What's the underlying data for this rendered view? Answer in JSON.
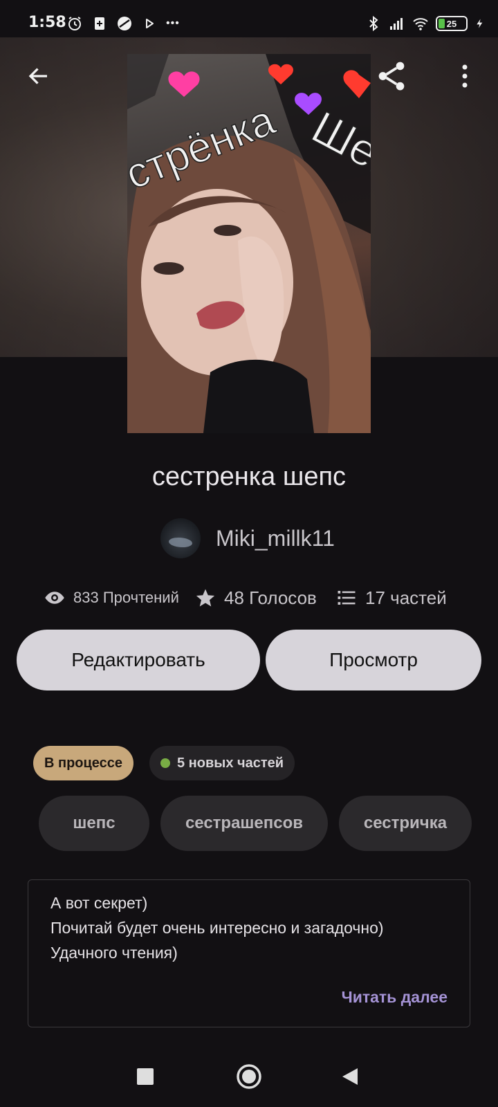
{
  "status_bar": {
    "time": "1:58",
    "battery": "25",
    "more_dots": "•••"
  },
  "header": {
    "icons": [
      "back-arrow-icon",
      "share-icon",
      "more-vertical-icon"
    ]
  },
  "cover": {
    "overlay_text_1": "стрёнка",
    "overlay_text_2": "Шеп"
  },
  "story": {
    "title": "сестренка шепс",
    "author": "Miki_millk11"
  },
  "stats": {
    "reads": "833 Прочтений",
    "votes": "48 Голосов",
    "parts": "17 частей"
  },
  "actions": {
    "edit_label": "Редактировать",
    "preview_label": "Просмотр"
  },
  "chips": {
    "status": "В процессе",
    "new_parts": "5 новых частей"
  },
  "tags": [
    "шепс",
    "сестрашепсов",
    "сестричка"
  ],
  "description": {
    "lines": [
      "А вот секрет)",
      "Почитай  будет очень интересно и загадочно)",
      "Удачного чтения)"
    ],
    "read_more": "Читать далее"
  },
  "colors": {
    "background": "#121013",
    "button": "#d7d4da",
    "status_chip": "#c8a87b",
    "new_dot": "#79ad45",
    "link": "#a593d6"
  }
}
